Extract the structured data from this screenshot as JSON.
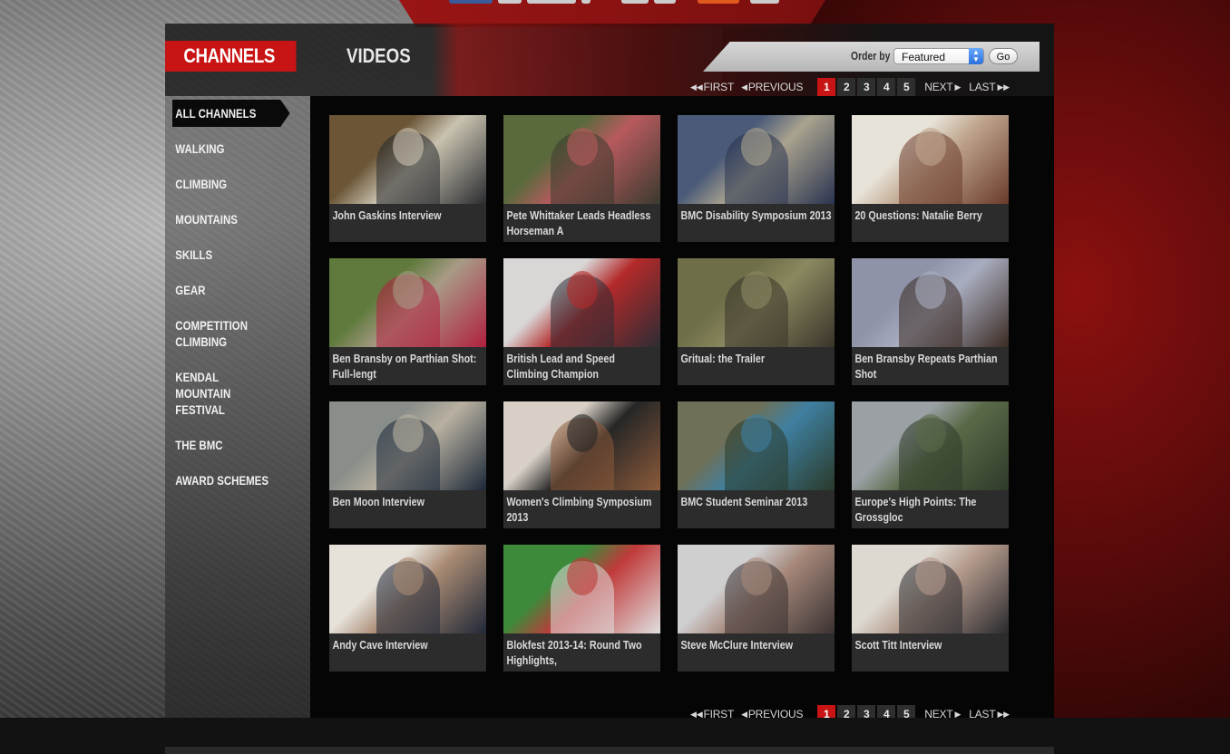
{
  "tabs": {
    "channels": "CHANNELS",
    "videos": "VIDEOS"
  },
  "order": {
    "label": "Order by",
    "selected": "Featured",
    "go": "Go"
  },
  "pager": {
    "first": "FIRST",
    "previous": "PREVIOUS",
    "next": "NEXT",
    "last": "LAST",
    "pages": [
      "1",
      "2",
      "3",
      "4",
      "5"
    ],
    "current_page": "1"
  },
  "sidebar": {
    "items": [
      {
        "label": "ALL CHANNELS",
        "active": true
      },
      {
        "label": "WALKING"
      },
      {
        "label": "CLIMBING"
      },
      {
        "label": "MOUNTAINS"
      },
      {
        "label": "SKILLS"
      },
      {
        "label": "GEAR"
      },
      {
        "label": "COMPETITION CLIMBING"
      },
      {
        "label": "KENDAL MOUNTAIN FESTIVAL"
      },
      {
        "label": "THE BMC"
      },
      {
        "label": "AWARD SCHEMES"
      }
    ]
  },
  "videos": [
    {
      "title": "John Gaskins Interview",
      "colors": [
        "#6b5536",
        "#c9c2b0",
        "#2a2c30"
      ]
    },
    {
      "title": "Pete Whittaker Leads Headless Horseman A",
      "colors": [
        "#5a6a3c",
        "#b75a5e",
        "#3a3a2e"
      ]
    },
    {
      "title": "BMC Disability Symposium 2013",
      "colors": [
        "#4b5a78",
        "#a9a28e",
        "#2a3450"
      ]
    },
    {
      "title": "20 Questions: Natalie Berry",
      "colors": [
        "#e8e3d8",
        "#bfa58e",
        "#6a3a2a"
      ]
    },
    {
      "title": "Ben Bransby on Parthian Shot: Full-lengt",
      "colors": [
        "#5f7a3c",
        "#a89a86",
        "#b02040"
      ]
    },
    {
      "title": "British Lead and Speed Climbing Champion",
      "colors": [
        "#d9d6d6",
        "#b42a2a",
        "#2c2c34"
      ]
    },
    {
      "title": "Gritual: the Trailer",
      "colors": [
        "#6e6e48",
        "#8a8860",
        "#3a342a"
      ]
    },
    {
      "title": "Ben Bransby Repeats Parthian Shot",
      "colors": [
        "#8e93a8",
        "#a9adc0",
        "#3a2a22"
      ]
    },
    {
      "title": "Ben Moon Interview",
      "colors": [
        "#8a8e8a",
        "#b8b0a0",
        "#1c2838"
      ]
    },
    {
      "title": "Women's Climbing Symposium 2013",
      "colors": [
        "#d8d0c6",
        "#262626",
        "#8c5a3a"
      ]
    },
    {
      "title": "BMC Student Seminar 2013",
      "colors": [
        "#6e7058",
        "#3f7fa0",
        "#2a3a2a"
      ]
    },
    {
      "title": "Europe's High Points: The Grossgloc",
      "colors": [
        "#9aa0a4",
        "#5a6a48",
        "#2e3a2a"
      ]
    },
    {
      "title": "Andy Cave Interview",
      "colors": [
        "#e6e2da",
        "#a88a72",
        "#202838"
      ]
    },
    {
      "title": "Blokfest 2013-14: Round Two Highlights,",
      "colors": [
        "#3c8a3a",
        "#c03a3a",
        "#e0e0e0"
      ]
    },
    {
      "title": "Steve McClure Interview",
      "colors": [
        "#cfcfd0",
        "#a6887a",
        "#3a3232"
      ]
    },
    {
      "title": "Scott Titt Interview",
      "colors": [
        "#ddd8d0",
        "#b49a8c",
        "#2a2a2e"
      ]
    }
  ],
  "colors": {
    "accent_red": "#c81414",
    "page_bg": "#050505"
  }
}
